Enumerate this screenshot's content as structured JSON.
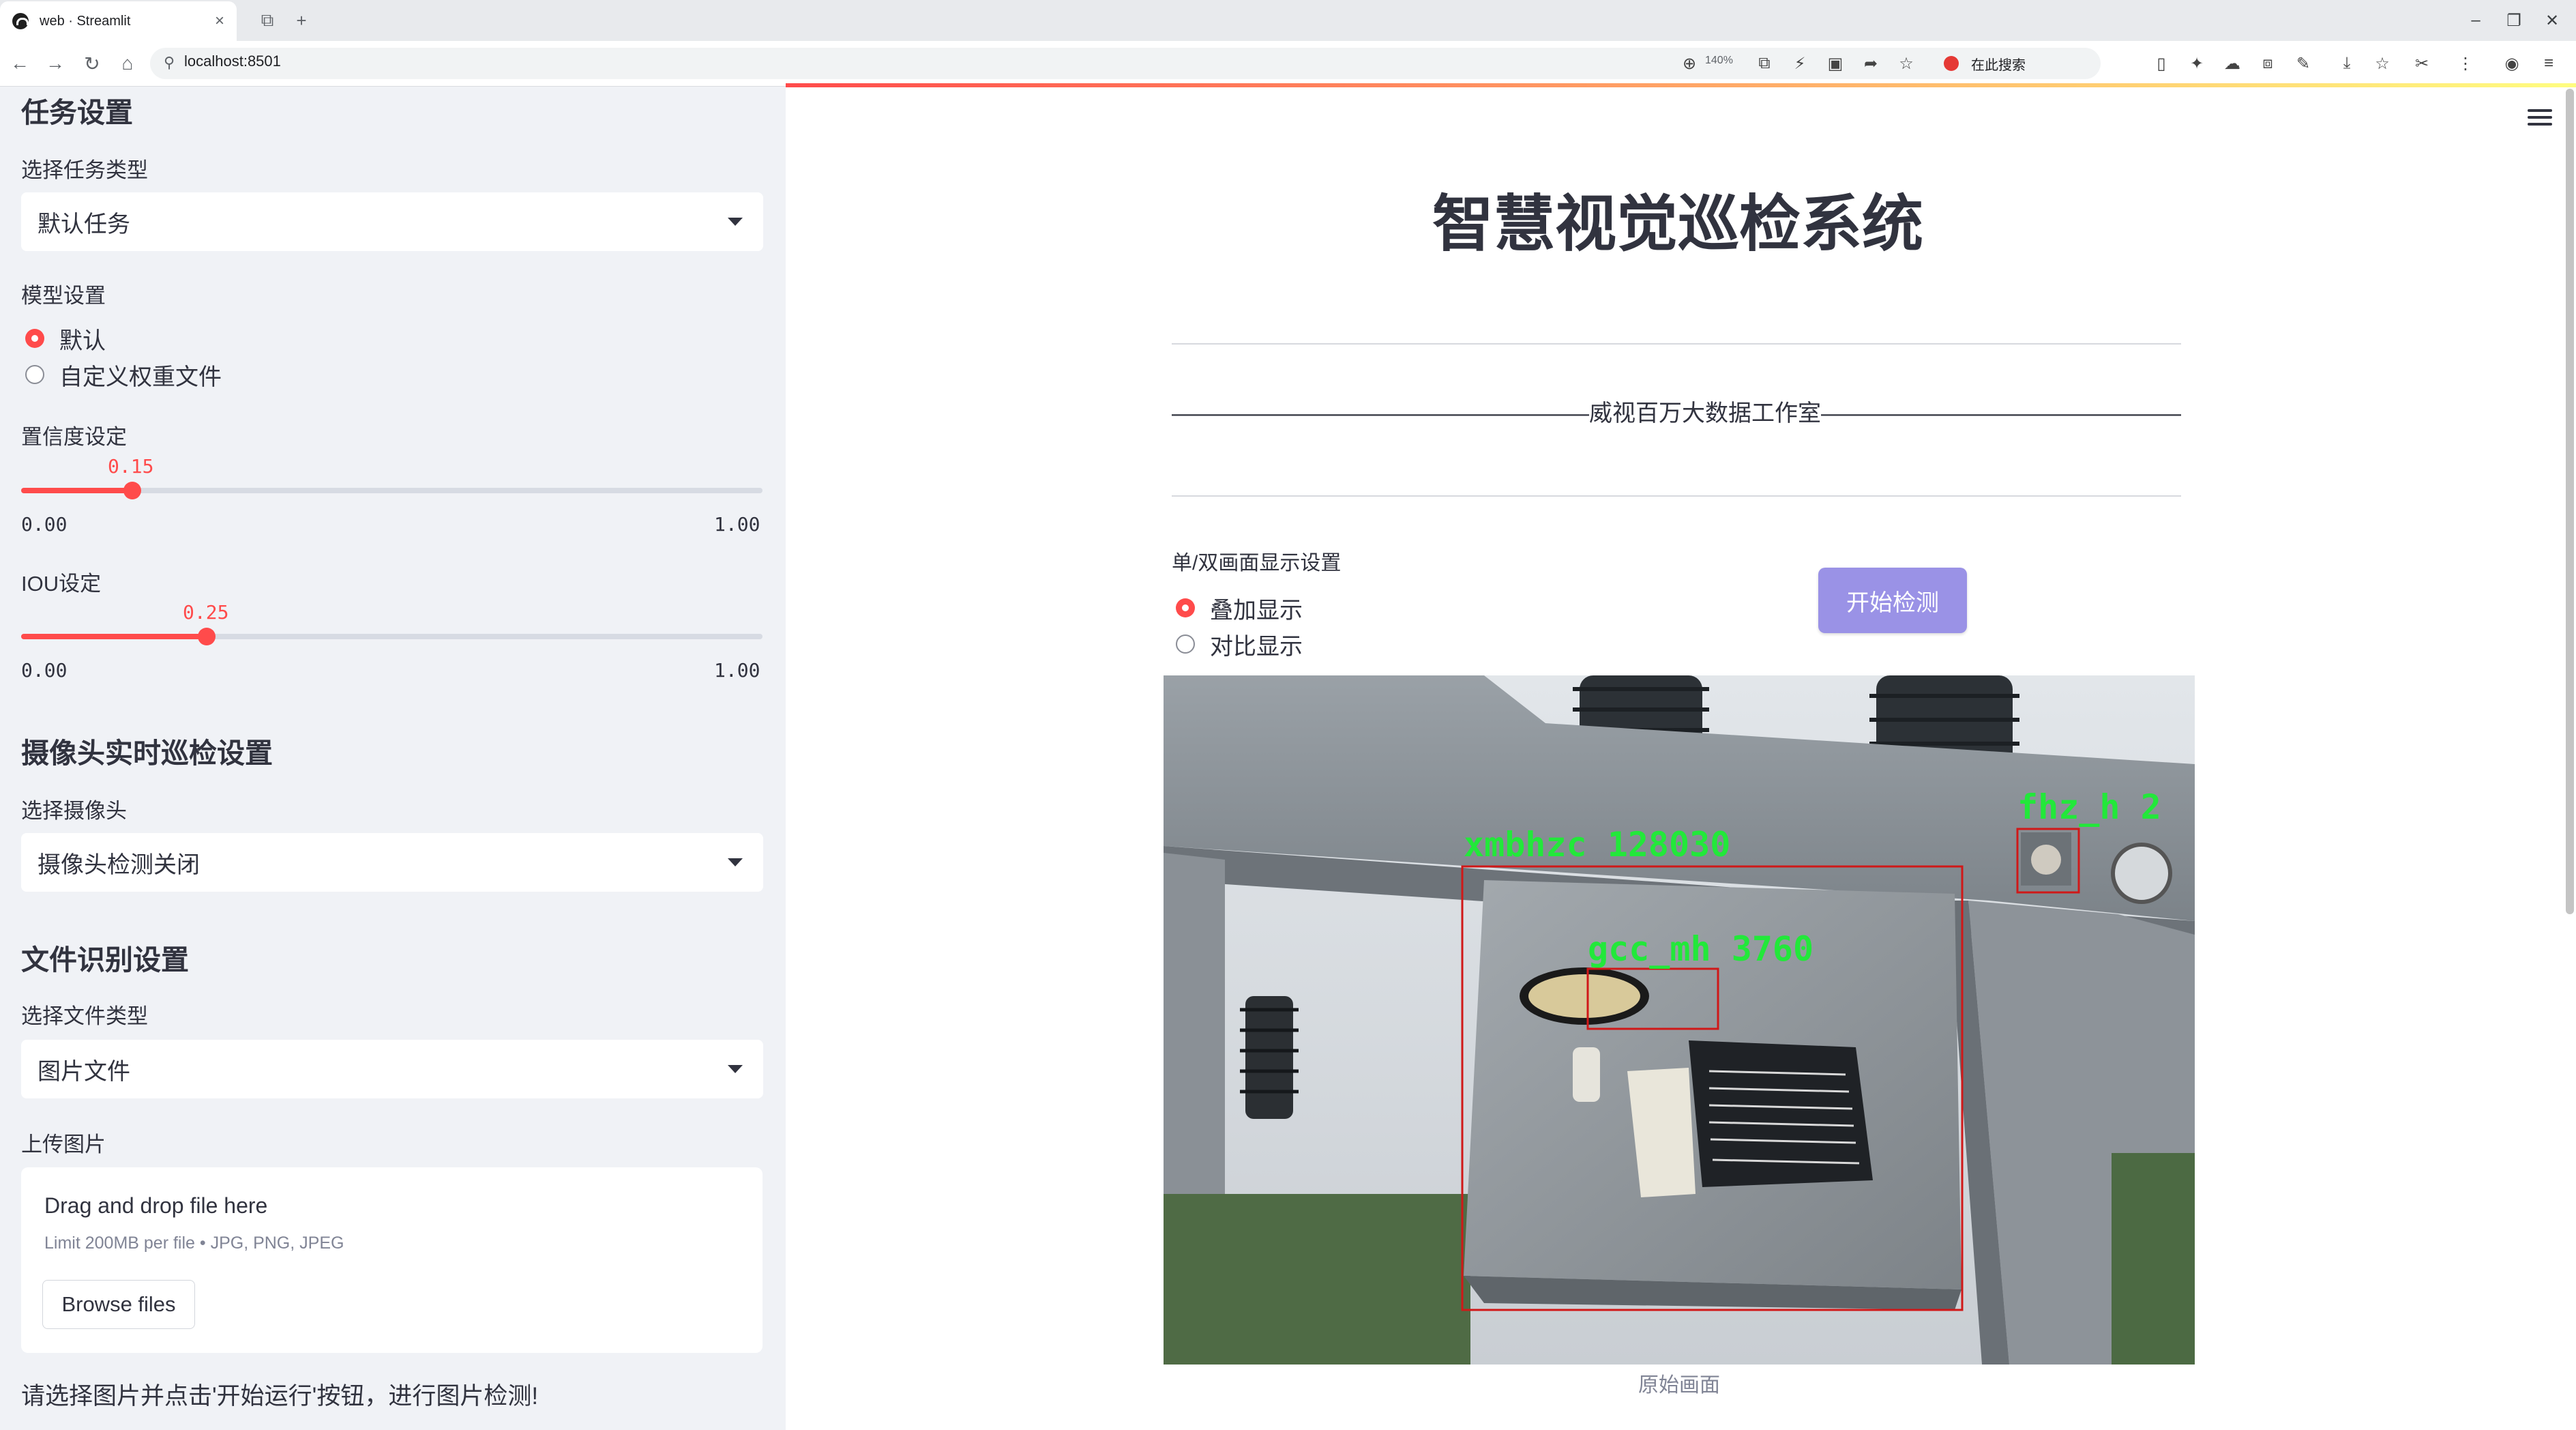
{
  "browser": {
    "tab_title": "web · Streamlit",
    "url": "localhost:8501",
    "zoom": "140%",
    "search_placeholder": "在此搜索"
  },
  "sidebar": {
    "task_heading": "任务设置",
    "task_type_label": "选择任务类型",
    "task_type_value": "默认任务",
    "model_label": "模型设置",
    "model_options": [
      "默认",
      "自定义权重文件"
    ],
    "model_selected": "默认",
    "confidence": {
      "label": "置信度设定",
      "value": "0.15",
      "min": "0.00",
      "max": "1.00",
      "fraction": 0.15
    },
    "iou": {
      "label": "IOU设定",
      "value": "0.25",
      "min": "0.00",
      "max": "1.00",
      "fraction": 0.25
    },
    "camera_heading": "摄像头实时巡检设置",
    "camera_label": "选择摄像头",
    "camera_value": "摄像头检测关闭",
    "file_heading": "文件识别设置",
    "file_type_label": "选择文件类型",
    "file_type_value": "图片文件",
    "upload_label": "上传图片",
    "upload_title": "Drag and drop file here",
    "upload_limit": "Limit 200MB per file • JPG, PNG, JPEG",
    "browse_label": "Browse files",
    "note": "请选择图片并点击'开始运行'按钮，进行图片检测!"
  },
  "main": {
    "title": "智慧视觉巡检系统",
    "subtitle": "——————————————————威视百万大数据工作室———————————————————",
    "display_label": "单/双画面显示设置",
    "display_options": [
      "叠加显示",
      "对比显示"
    ],
    "display_selected": "叠加显示",
    "start_button": "开始检测",
    "image_caption": "原始画面",
    "detections": [
      {
        "label": "xmbhzc 128030"
      },
      {
        "label": "gcc_mh 3760"
      },
      {
        "label": "fhz_h 2"
      }
    ]
  },
  "colors": {
    "accent": "#ff4b4b",
    "button": "#9a92e6",
    "box": "#d01818",
    "box_label": "#22e83a"
  }
}
